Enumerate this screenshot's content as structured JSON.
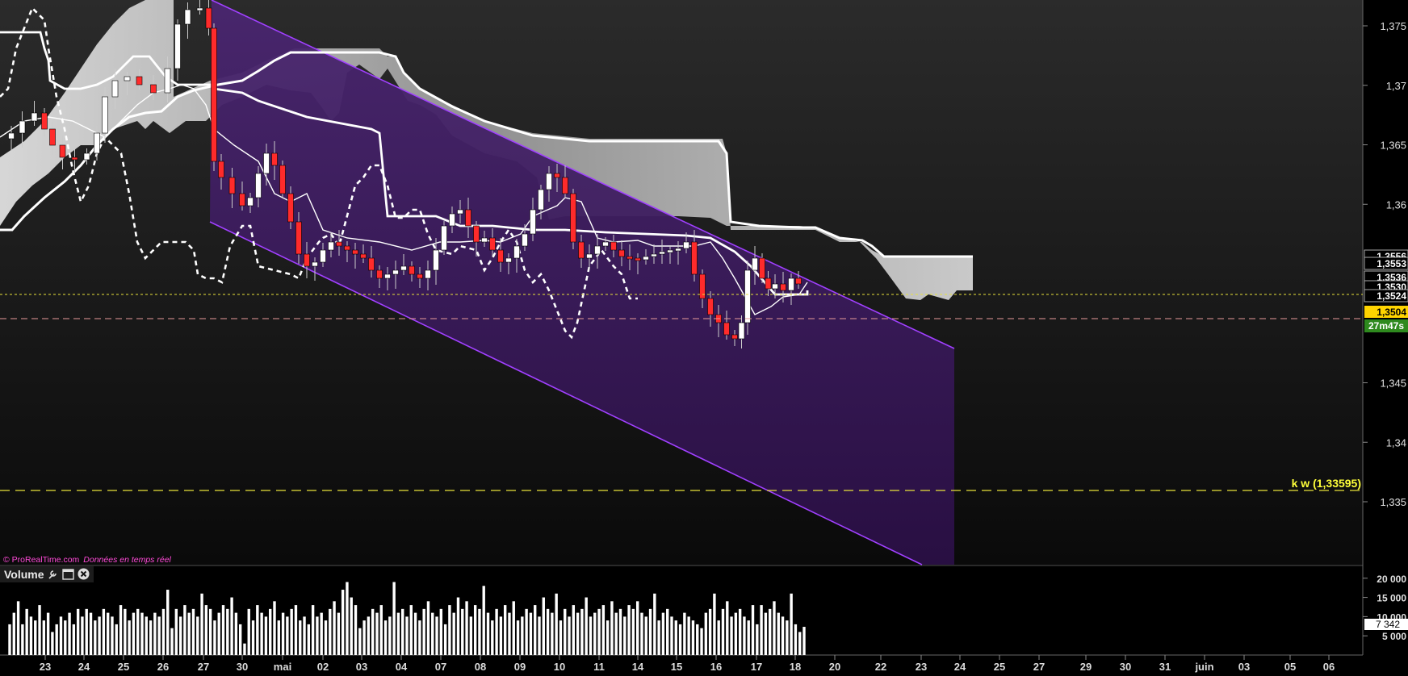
{
  "chart_data": {
    "type": "candlestick",
    "y_axis": {
      "range": [
        1.3305,
        1.3765
      ],
      "ticks": [
        {
          "value": 1.375,
          "label": "1,375"
        },
        {
          "value": 1.37,
          "label": "1,37"
        },
        {
          "value": 1.365,
          "label": "1,365"
        },
        {
          "value": 1.36,
          "label": "1,36"
        },
        {
          "value": 1.345,
          "label": "1,345"
        },
        {
          "value": 1.34,
          "label": "1,34"
        },
        {
          "value": 1.335,
          "label": "1,335"
        }
      ]
    },
    "x_axis": {
      "labels": [
        "23",
        "24",
        "25",
        "26",
        "27",
        "30",
        "mai",
        "02",
        "03",
        "04",
        "07",
        "08",
        "09",
        "10",
        "11",
        "14",
        "15",
        "16",
        "17",
        "18",
        "20",
        "22",
        "23",
        "24",
        "25",
        "27",
        "29",
        "30",
        "31",
        "juin",
        "03",
        "05",
        "06"
      ]
    },
    "price_markers": [
      {
        "value": 1.3556,
        "label": "1,3556",
        "color": "#ffffff"
      },
      {
        "value": 1.3553,
        "label": "1,3553",
        "color": "#ffffff"
      },
      {
        "value": 1.3536,
        "label": "1,3536",
        "color": "#ffffff"
      },
      {
        "value": 1.353,
        "label": "1,3530",
        "color": "#ffffff"
      },
      {
        "value": 1.3524,
        "label": "1,3524",
        "color": "#ffffff"
      },
      {
        "value": 1.3504,
        "label": "1,3504",
        "color": "#ffd400"
      }
    ],
    "countdown_label": "27m47s",
    "horizontal_lines": [
      {
        "value": 1.3524,
        "style": "dotted",
        "color": "#e8e23a"
      },
      {
        "value": 1.3504,
        "style": "dashed",
        "color": "#e89a9a"
      },
      {
        "value": 1.33595,
        "style": "dashed",
        "color": "#e8e23a",
        "label": "k w (1,33595)"
      }
    ],
    "watermark": "© ProRealTime.com",
    "watermark_note": "Données en temps réel",
    "volume": {
      "title": "Volume",
      "ticks": [
        {
          "value": 20000,
          "label": "20 000"
        },
        {
          "value": 15000,
          "label": "15 000"
        },
        {
          "value": 10000,
          "label": "10 000"
        },
        {
          "value": 5000,
          "label": "5 000"
        }
      ],
      "last_value_label": "7 342",
      "values": [
        8000,
        11000,
        14000,
        8000,
        12000,
        10000,
        9000,
        13000,
        9000,
        11000,
        6000,
        8000,
        10000,
        9000,
        11000,
        8000,
        12000,
        10000,
        12000,
        11000,
        9000,
        10000,
        12000,
        11000,
        10000,
        8000,
        13000,
        12000,
        9000,
        11000,
        12000,
        11000,
        10000,
        9000,
        11000,
        10000,
        12000,
        17000,
        7000,
        12000,
        10000,
        13000,
        11000,
        12000,
        10000,
        16000,
        13000,
        12000,
        9000,
        11000,
        13000,
        12000,
        15000,
        11000,
        8000,
        3000,
        12000,
        9000,
        13000,
        11000,
        10000,
        12000,
        14000,
        9000,
        11000,
        10000,
        12000,
        13000,
        9000,
        10000,
        8000,
        13000,
        10000,
        11000,
        9000,
        12000,
        14000,
        11000,
        17000,
        19000,
        15000,
        13000,
        7000,
        9000,
        10000,
        12000,
        11000,
        13000,
        9000,
        10000,
        19000,
        11000,
        12000,
        10000,
        13000,
        11000,
        9000,
        12000,
        14000,
        11000,
        10000,
        12000,
        8000,
        13000,
        11000,
        15000,
        12000,
        14000,
        10000,
        13000,
        12000,
        18000,
        11000,
        9000,
        12000,
        10000,
        13000,
        11000,
        14000,
        9000,
        10000,
        12000,
        11000,
        13000,
        10000,
        15000,
        12000,
        11000,
        16000,
        9000,
        12000,
        10000,
        13000,
        11000,
        12000,
        15000,
        10000,
        11000,
        12000,
        13000,
        9000,
        14000,
        11000,
        12000,
        10000,
        13000,
        12000,
        14000,
        11000,
        10000,
        12000,
        16000,
        9000,
        11000,
        12000,
        10000,
        9000,
        8000,
        11000,
        10000,
        9000,
        8000,
        7000,
        11000,
        12000,
        16000,
        9000,
        12000,
        14000,
        10000,
        11000,
        12000,
        10000,
        9000,
        13000,
        8000,
        13000,
        11000,
        12000,
        14000,
        11000,
        10000,
        9000,
        16000,
        8000,
        6000,
        7342
      ]
    }
  }
}
